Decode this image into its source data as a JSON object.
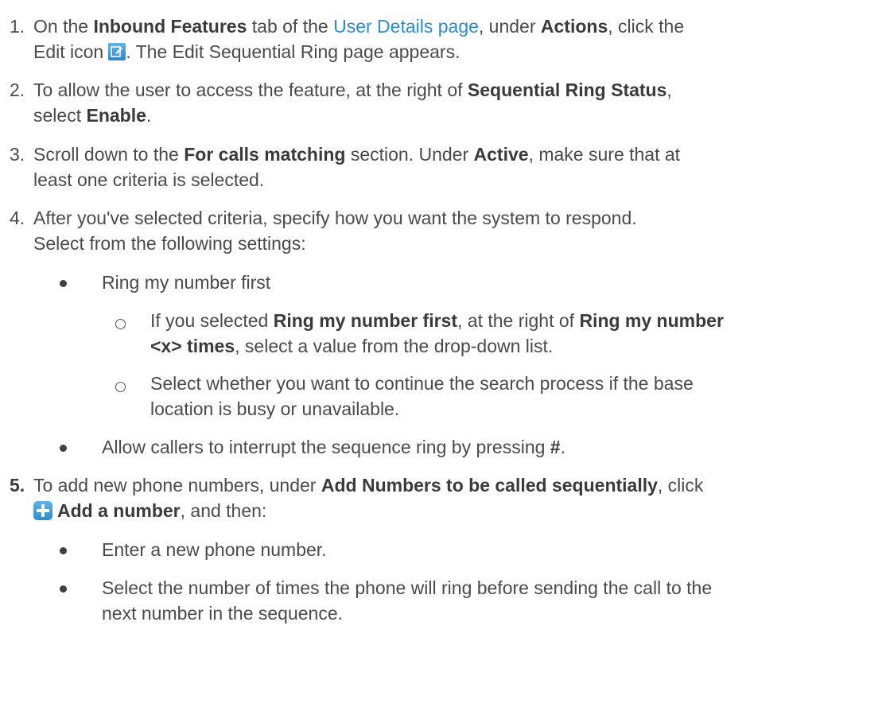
{
  "steps": [
    {
      "number": "1.",
      "line1": {
        "a": "On the ",
        "b": "Inbound Features",
        "c": " tab of the ",
        "link": "User Details page",
        "d": ", under ",
        "e": "Actions",
        "f": ", click the"
      },
      "line2": {
        "a": "Edit icon",
        "icon": "edit-icon",
        "b": ". The Edit Sequential Ring page appears."
      }
    },
    {
      "number": "2.",
      "line1": {
        "a": "To allow the user to access the feature, at the right of ",
        "b": "Sequential Ring Status",
        "c": ","
      },
      "line2": {
        "a": "select ",
        "b": "Enable",
        "c": "."
      }
    },
    {
      "number": "3.",
      "line1": {
        "a": "Scroll down to the ",
        "b": "For calls matching",
        "c": " section. Under ",
        "d": "Active",
        "e": ", make sure that at"
      },
      "line2": {
        "a": "least one criteria is selected."
      }
    },
    {
      "number": "4.",
      "line1": {
        "a": "After you've selected criteria, specify how you want the system to respond."
      },
      "line2": {
        "a": "Select from the following settings:"
      },
      "bullets": [
        {
          "text": "Ring my number first",
          "sub": [
            {
              "line1": {
                "a": "If you selected ",
                "b": "Ring my number first",
                "c": ", at the right of ",
                "d": "Ring my number"
              },
              "line2": {
                "a": "<x> times",
                "b": ", select a value from the drop-down list."
              }
            },
            {
              "line1": {
                "a": "Select whether you want to continue the search process if the base"
              },
              "line2": {
                "a": "location is busy or unavailable."
              }
            }
          ]
        },
        {
          "text": "Allow callers to interrupt the sequence ring by pressing ",
          "bold": "#",
          "end": "."
        }
      ]
    },
    {
      "number": "5.",
      "line1": {
        "a": "To add new phone numbers, under ",
        "b": "Add Numbers to be called sequentially",
        "c": ", click"
      },
      "line2": {
        "icon": "add-icon",
        "a": "Add a number",
        "b": ", and then:"
      },
      "bullets": [
        {
          "text": "Enter a new phone number."
        },
        {
          "line1": "Select the number of times the phone will ring before sending the call to the",
          "line2": "next number in the sequence."
        }
      ]
    }
  ]
}
